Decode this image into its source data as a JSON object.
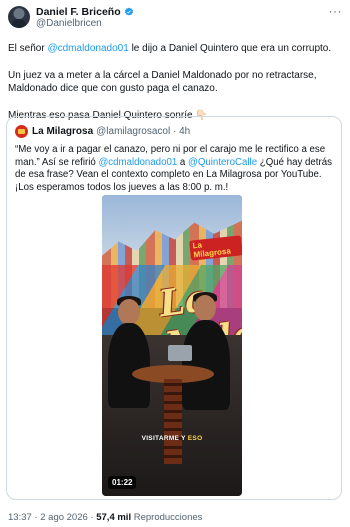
{
  "author": {
    "display_name": "Daniel F. Briceño",
    "handle": "@Danielbricen",
    "verified": true
  },
  "more_menu_icon": "ellipsis-icon",
  "tweet": {
    "p1_pre": "El señor ",
    "p1_mention": "@cdmaldonado01",
    "p1_post": " le dijo a Daniel Quintero que era un corrupto.",
    "p2": "Un juez va a meter a la cárcel a Daniel Maldonado por no retractarse, Maldonado dice que con gusto paga el canazo.",
    "p3": "Mientras eso pasa Daniel Quintero sonríe 👇🏻"
  },
  "quote": {
    "display_name": "La Milagrosa",
    "handle": "@lamilagrosacol",
    "time": "4h",
    "text_1": "“Me voy a ir a pagar el canazo, pero ni por el carajo me le rectifico a ese man.” Así se refirió ",
    "mention_1": "@cdmaldonado01",
    "text_2": " a ",
    "mention_2": "@QuinteroCalle",
    "text_3": " ¿Qué hay detrás de esa frase? Vean el contexto completo en La Milagrosa por YouTube. ¡Los esperamos todos los jueves a las 8:00 p. m.!",
    "video": {
      "mural_text": "La Mila",
      "overlay_logo": "La Milagrosa",
      "caption_white": "VISITARME Y",
      "caption_yellow": "ESO",
      "duration": "01:22"
    }
  },
  "footer": {
    "time": "13:37",
    "separator": "·",
    "date": "2 ago 2026",
    "views": "57,4 mil",
    "views_label": "Reproducciones"
  },
  "colors": {
    "accent": "#1d9bf0",
    "text": "#0f1419",
    "secondary": "#536471",
    "border": "#cfd9de"
  }
}
